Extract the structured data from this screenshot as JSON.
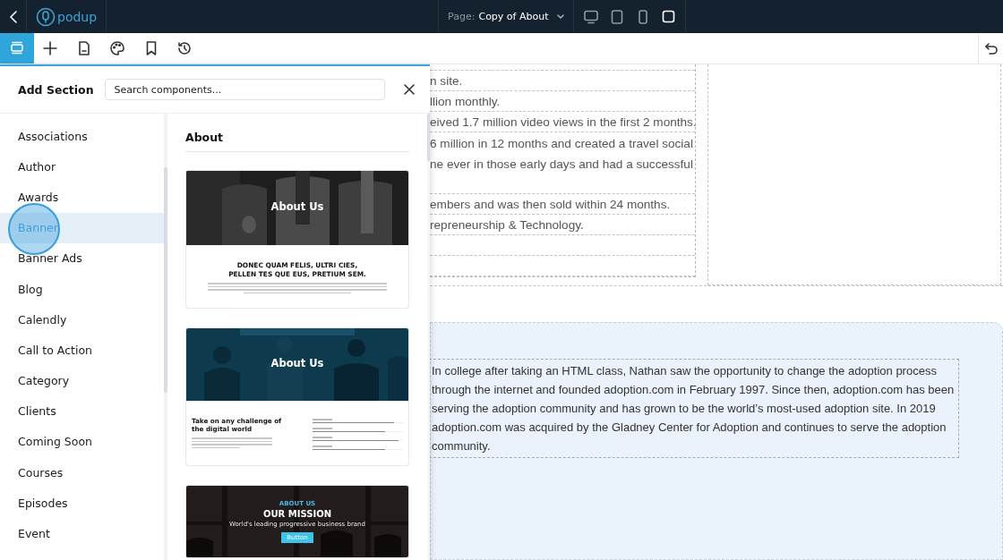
{
  "top_bar": {
    "logo": "podup",
    "page_label": "Page:",
    "page_name": "Copy of About",
    "devices": [
      {
        "kind": "desktop",
        "selected": false
      },
      {
        "kind": "tablet",
        "selected": false
      },
      {
        "kind": "phone",
        "selected": false
      },
      {
        "kind": "square",
        "selected": true
      }
    ]
  },
  "toolbar": {
    "tools": [
      {
        "kind": "sections",
        "selected": true
      },
      {
        "kind": "add",
        "selected": false
      },
      {
        "kind": "page",
        "selected": false
      },
      {
        "kind": "palette",
        "selected": false
      },
      {
        "kind": "bookmark",
        "selected": false
      },
      {
        "kind": "history",
        "selected": false
      }
    ]
  },
  "panel": {
    "title": "Add Section",
    "search": {
      "placeholder": "Search components..."
    },
    "categories": [
      {
        "label": "Associations",
        "selected": false
      },
      {
        "label": "Author",
        "selected": false
      },
      {
        "label": "Awards",
        "selected": false
      },
      {
        "label": "Banner",
        "selected": true
      },
      {
        "label": "Banner Ads",
        "selected": false
      },
      {
        "label": "Blog",
        "selected": false
      },
      {
        "label": "Calendly",
        "selected": false
      },
      {
        "label": "Call to Action",
        "selected": false
      },
      {
        "label": "Category",
        "selected": false
      },
      {
        "label": "Clients",
        "selected": false
      },
      {
        "label": "Coming Soon",
        "selected": false
      },
      {
        "label": "Courses",
        "selected": false
      },
      {
        "label": "Episodes",
        "selected": false
      },
      {
        "label": "Event",
        "selected": false
      }
    ],
    "group_title": "About",
    "templates": [
      {
        "kind": "banner_text",
        "title": "About Us",
        "heading": "DONEC QUAM FELIS, ULTRI CIES,\nPELLEN TES QUE EUS, PRETIUM SEM."
      },
      {
        "kind": "banner_skills",
        "title": "About Us",
        "heading": "Take on any challenge of the digital world"
      },
      {
        "kind": "mission",
        "eyebrow": "ABOUT US",
        "title": "OUR MISSION",
        "subtitle": "World's leading progressive business brand",
        "button": "Button"
      }
    ]
  },
  "canvas": {
    "rows": [
      {
        "lines": [
          "n site."
        ]
      },
      {
        "lines": [
          "llion monthly."
        ]
      },
      {
        "lines": [
          "eived 1.7 million video views in the first 2 months."
        ]
      },
      {
        "lines": [
          "6 million in 12 months and created a travel social",
          "ne ever in those early days and had a successful"
        ]
      },
      {
        "lines": [
          "embers and was then sold within 24 months."
        ]
      },
      {
        "lines": [
          "repreneurship & Technology."
        ]
      },
      {
        "lines": []
      },
      {
        "lines": []
      }
    ],
    "paragraph": "In college after taking an HTML class, Nathan saw the opportunity to change the adoption process through the internet and founded adoption.com in February 1997. Since then, adoption.com has been serving the adoption community and has grown to be the world’s most-used adoption site. In 2019 adoption.com was acquired by the Gladney Center for Adoption and continues to serve the adoption community."
  }
}
